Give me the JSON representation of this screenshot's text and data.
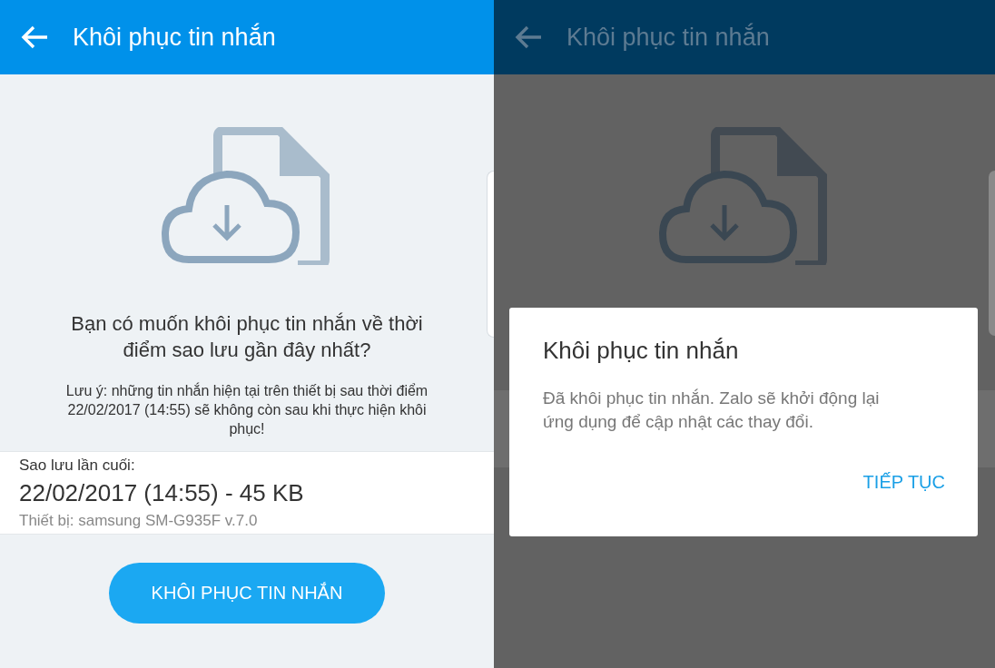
{
  "screens": [
    {
      "title": "Khôi phục tin nhắn",
      "dimmed": false,
      "question": "Bạn có muốn khôi phục tin nhắn về thời điểm sao lưu gần đây nhất?",
      "note": "Lưu ý: những tin nhắn hiện tại trên thiết bị sau thời điểm 22/02/2017 (14:55) sẽ không còn sau khi thực hiện khôi phục!",
      "backup_label": "Sao lưu lần cuối:",
      "backup_value": "22/02/2017 (14:55) - 45 KB",
      "device": "Thiết bị: samsung SM-G935F v.7.0",
      "restore_button": "KHÔI PHỤC TIN NHẮN"
    },
    {
      "title": "Khôi phục tin nhắn",
      "dimmed": true,
      "dialog": {
        "title": "Khôi phục tin nhắn",
        "message": "Đã khôi phục tin nhắn. Zalo sẽ khởi động lại ứng dụng để cập nhật các thay đổi.",
        "button": "TIẾP TỤC"
      }
    }
  ]
}
